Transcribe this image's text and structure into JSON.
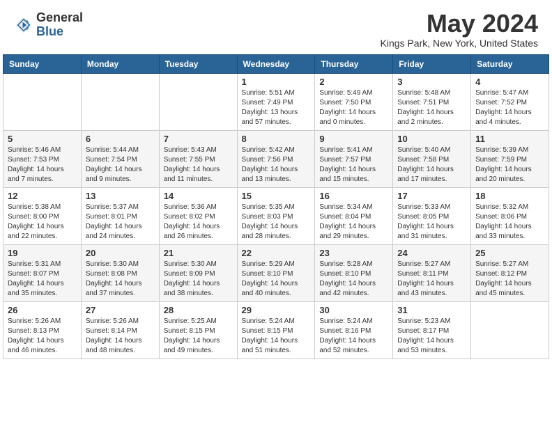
{
  "header": {
    "logo_general": "General",
    "logo_blue": "Blue",
    "month_title": "May 2024",
    "location": "Kings Park, New York, United States"
  },
  "days_of_week": [
    "Sunday",
    "Monday",
    "Tuesday",
    "Wednesday",
    "Thursday",
    "Friday",
    "Saturday"
  ],
  "weeks": [
    [
      {
        "day": "",
        "info": ""
      },
      {
        "day": "",
        "info": ""
      },
      {
        "day": "",
        "info": ""
      },
      {
        "day": "1",
        "info": "Sunrise: 5:51 AM\nSunset: 7:49 PM\nDaylight: 13 hours and 57 minutes."
      },
      {
        "day": "2",
        "info": "Sunrise: 5:49 AM\nSunset: 7:50 PM\nDaylight: 14 hours and 0 minutes."
      },
      {
        "day": "3",
        "info": "Sunrise: 5:48 AM\nSunset: 7:51 PM\nDaylight: 14 hours and 2 minutes."
      },
      {
        "day": "4",
        "info": "Sunrise: 5:47 AM\nSunset: 7:52 PM\nDaylight: 14 hours and 4 minutes."
      }
    ],
    [
      {
        "day": "5",
        "info": "Sunrise: 5:46 AM\nSunset: 7:53 PM\nDaylight: 14 hours and 7 minutes."
      },
      {
        "day": "6",
        "info": "Sunrise: 5:44 AM\nSunset: 7:54 PM\nDaylight: 14 hours and 9 minutes."
      },
      {
        "day": "7",
        "info": "Sunrise: 5:43 AM\nSunset: 7:55 PM\nDaylight: 14 hours and 11 minutes."
      },
      {
        "day": "8",
        "info": "Sunrise: 5:42 AM\nSunset: 7:56 PM\nDaylight: 14 hours and 13 minutes."
      },
      {
        "day": "9",
        "info": "Sunrise: 5:41 AM\nSunset: 7:57 PM\nDaylight: 14 hours and 15 minutes."
      },
      {
        "day": "10",
        "info": "Sunrise: 5:40 AM\nSunset: 7:58 PM\nDaylight: 14 hours and 17 minutes."
      },
      {
        "day": "11",
        "info": "Sunrise: 5:39 AM\nSunset: 7:59 PM\nDaylight: 14 hours and 20 minutes."
      }
    ],
    [
      {
        "day": "12",
        "info": "Sunrise: 5:38 AM\nSunset: 8:00 PM\nDaylight: 14 hours and 22 minutes."
      },
      {
        "day": "13",
        "info": "Sunrise: 5:37 AM\nSunset: 8:01 PM\nDaylight: 14 hours and 24 minutes."
      },
      {
        "day": "14",
        "info": "Sunrise: 5:36 AM\nSunset: 8:02 PM\nDaylight: 14 hours and 26 minutes."
      },
      {
        "day": "15",
        "info": "Sunrise: 5:35 AM\nSunset: 8:03 PM\nDaylight: 14 hours and 28 minutes."
      },
      {
        "day": "16",
        "info": "Sunrise: 5:34 AM\nSunset: 8:04 PM\nDaylight: 14 hours and 29 minutes."
      },
      {
        "day": "17",
        "info": "Sunrise: 5:33 AM\nSunset: 8:05 PM\nDaylight: 14 hours and 31 minutes."
      },
      {
        "day": "18",
        "info": "Sunrise: 5:32 AM\nSunset: 8:06 PM\nDaylight: 14 hours and 33 minutes."
      }
    ],
    [
      {
        "day": "19",
        "info": "Sunrise: 5:31 AM\nSunset: 8:07 PM\nDaylight: 14 hours and 35 minutes."
      },
      {
        "day": "20",
        "info": "Sunrise: 5:30 AM\nSunset: 8:08 PM\nDaylight: 14 hours and 37 minutes."
      },
      {
        "day": "21",
        "info": "Sunrise: 5:30 AM\nSunset: 8:09 PM\nDaylight: 14 hours and 38 minutes."
      },
      {
        "day": "22",
        "info": "Sunrise: 5:29 AM\nSunset: 8:10 PM\nDaylight: 14 hours and 40 minutes."
      },
      {
        "day": "23",
        "info": "Sunrise: 5:28 AM\nSunset: 8:10 PM\nDaylight: 14 hours and 42 minutes."
      },
      {
        "day": "24",
        "info": "Sunrise: 5:27 AM\nSunset: 8:11 PM\nDaylight: 14 hours and 43 minutes."
      },
      {
        "day": "25",
        "info": "Sunrise: 5:27 AM\nSunset: 8:12 PM\nDaylight: 14 hours and 45 minutes."
      }
    ],
    [
      {
        "day": "26",
        "info": "Sunrise: 5:26 AM\nSunset: 8:13 PM\nDaylight: 14 hours and 46 minutes."
      },
      {
        "day": "27",
        "info": "Sunrise: 5:26 AM\nSunset: 8:14 PM\nDaylight: 14 hours and 48 minutes."
      },
      {
        "day": "28",
        "info": "Sunrise: 5:25 AM\nSunset: 8:15 PM\nDaylight: 14 hours and 49 minutes."
      },
      {
        "day": "29",
        "info": "Sunrise: 5:24 AM\nSunset: 8:15 PM\nDaylight: 14 hours and 51 minutes."
      },
      {
        "day": "30",
        "info": "Sunrise: 5:24 AM\nSunset: 8:16 PM\nDaylight: 14 hours and 52 minutes."
      },
      {
        "day": "31",
        "info": "Sunrise: 5:23 AM\nSunset: 8:17 PM\nDaylight: 14 hours and 53 minutes."
      },
      {
        "day": "",
        "info": ""
      }
    ]
  ]
}
